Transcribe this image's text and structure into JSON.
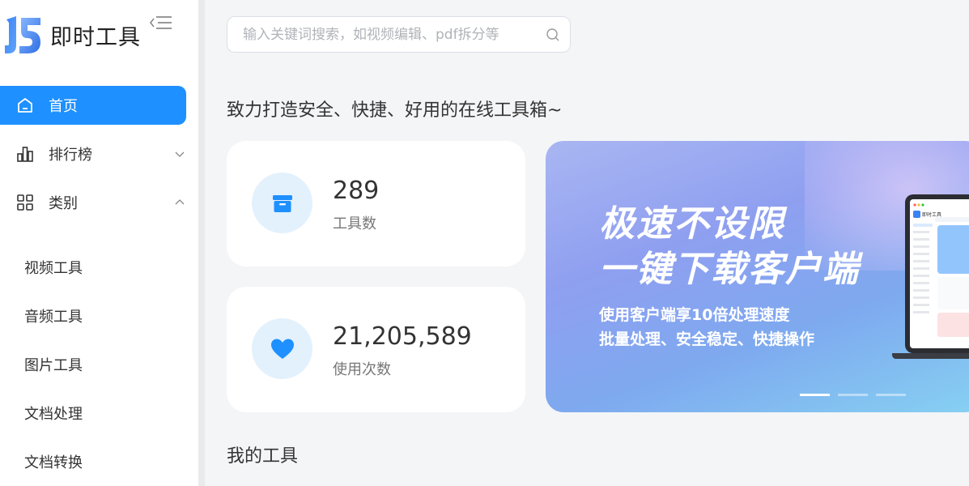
{
  "brand": {
    "name": "即时工具",
    "logo_icon": "js-logo-icon"
  },
  "nav": {
    "home": "首页",
    "ranking": "排行榜",
    "category": "类别",
    "sub_items": [
      "视频工具",
      "音频工具",
      "图片工具",
      "文档处理",
      "文档转换"
    ]
  },
  "search": {
    "placeholder": "输入关键词搜索，如视频编辑、pdf拆分等",
    "value": ""
  },
  "tagline": "致力打造安全、快捷、好用的在线工具箱~",
  "stats": [
    {
      "value": "289",
      "label": "工具数",
      "icon": "box-icon"
    },
    {
      "value": "21,205,589",
      "label": "使用次数",
      "icon": "heart-icon"
    }
  ],
  "banner": {
    "headline_1": "极速不设限",
    "headline_2": "一键下载客户端",
    "sub_1": "使用客户端享10倍处理速度",
    "sub_2": "批量处理、安全稳定、快捷操作",
    "laptop_brand": "即时工具",
    "slides": 3,
    "active_slide": 1
  },
  "section": {
    "my_tools": "我的工具"
  },
  "colors": {
    "accent": "#1e90ff",
    "icon_bg": "#e3f1fd",
    "page_bg": "#f4f5f7"
  }
}
